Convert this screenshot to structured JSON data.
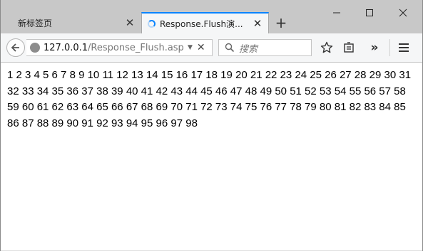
{
  "tabs": [
    {
      "label": "新标签页",
      "active": false
    },
    {
      "label": "Response.Flush演...",
      "active": true
    }
  ],
  "toolbar": {
    "url_host": "127.0.0.1",
    "url_path": "/Response_Flush.asp",
    "search_placeholder": "搜索"
  },
  "page": {
    "numbers_text": "1 2 3 4 5 6 7 8 9 10 11 12 13 14 15 16 17 18 19 20 21 22 23 24 25 26 27 28 29 30 31 32 33 34 35 36 37 38 39 40 41 42 43 44 45 46 47 48 49 50 51 52 53 54 55 56 57 58 59 60 61 62 63 64 65 66 67 68 69 70 71 72 73 74 75 76 77 78 79 80 81 82 83 84 85 86 87 88 89 90 91 92 93 94 95 96 97 98"
  },
  "colors": {
    "accent": "#0a84ff",
    "tabbar": "#c8c8c8",
    "toolbar": "#f5f6f7"
  },
  "icons": [
    "minimize-icon",
    "maximize-icon",
    "close-icon",
    "back-icon",
    "globe-icon",
    "search-icon",
    "bookmark-star-icon",
    "reading-list-icon",
    "overflow-chevron-icon",
    "menu-icon"
  ]
}
